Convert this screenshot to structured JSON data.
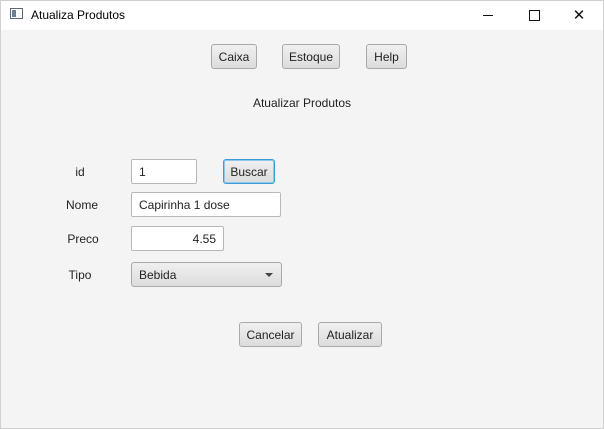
{
  "window": {
    "title": "Atualiza Produtos",
    "minimize_glyph": "",
    "maximize_glyph": "",
    "close_glyph": "✕"
  },
  "toolbar": {
    "caixa_label": "Caixa",
    "estoque_label": "Estoque",
    "help_label": "Help"
  },
  "form": {
    "heading": "Atualizar Produtos",
    "id_label": "id",
    "id_value": "1",
    "buscar_label": "Buscar",
    "nome_label": "Nome",
    "nome_value": "Capirinha 1 dose",
    "preco_label": "Preco",
    "preco_value": "4.55",
    "tipo_label": "Tipo",
    "tipo_selected": "Bebida"
  },
  "actions": {
    "cancelar_label": "Cancelar",
    "atualizar_label": "Atualizar"
  }
}
